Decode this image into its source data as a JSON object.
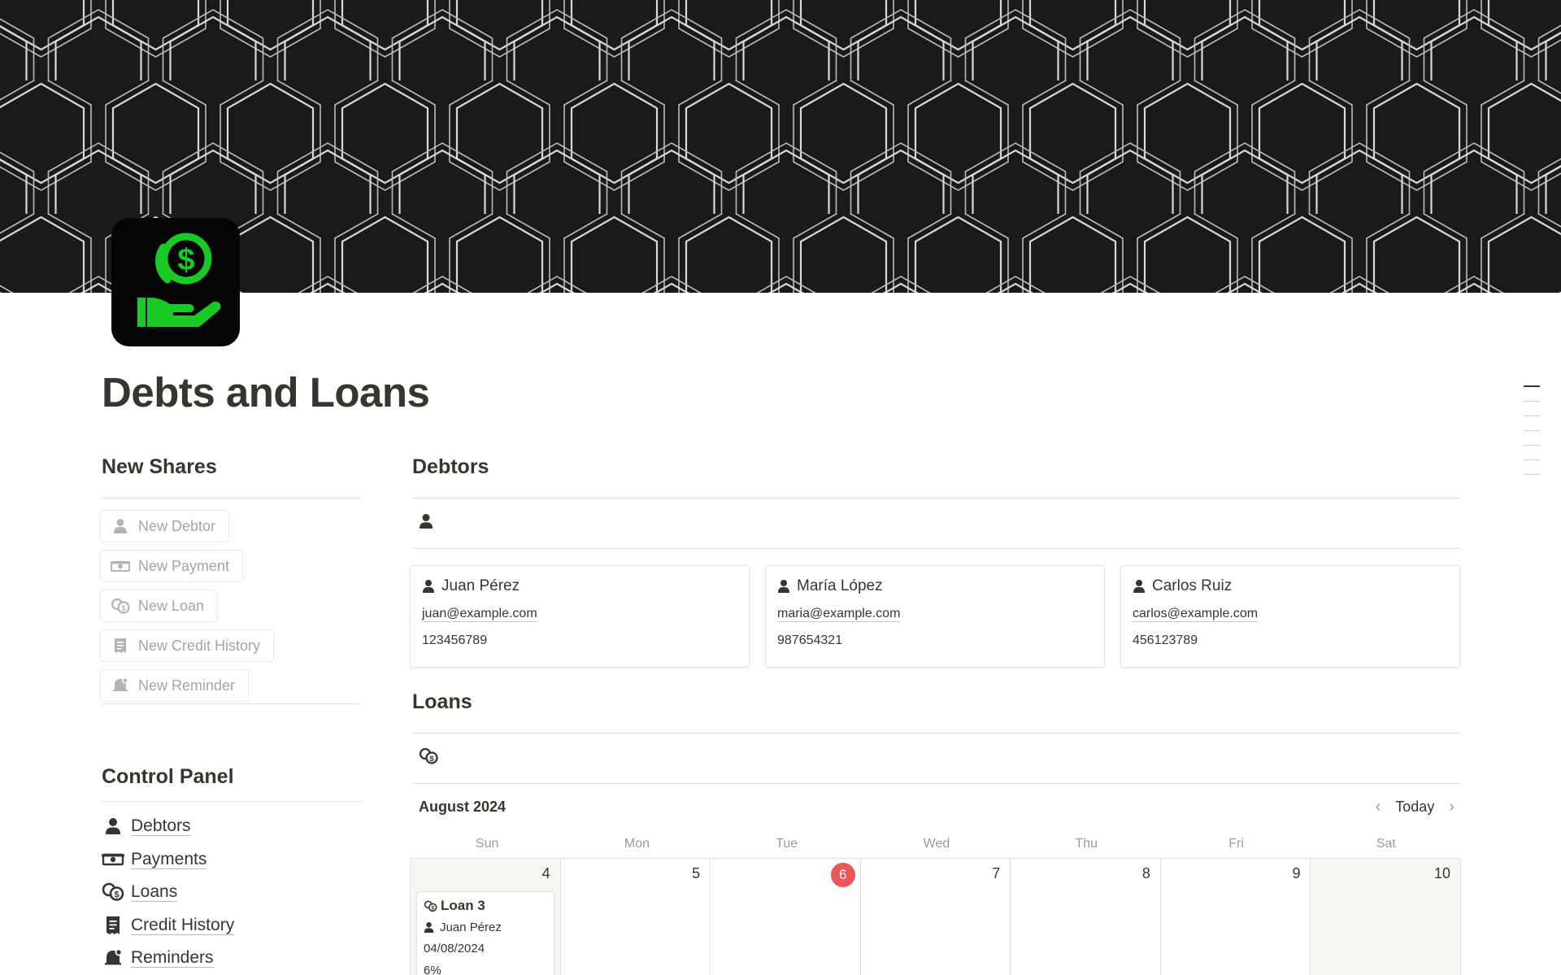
{
  "page": {
    "title": "Debts and Loans"
  },
  "icon": {
    "name": "hand-dollar-icon",
    "accent": "#18c928",
    "background": "#050505"
  },
  "new_shares": {
    "heading": "New Shares",
    "buttons": [
      {
        "label": "New Debtor",
        "icon": "person-icon"
      },
      {
        "label": "New Payment",
        "icon": "money-icon"
      },
      {
        "label": "New Loan",
        "icon": "coins-icon"
      },
      {
        "label": "New Credit History",
        "icon": "receipt-icon"
      },
      {
        "label": "New Reminder",
        "icon": "bell-icon"
      }
    ]
  },
  "control_panel": {
    "heading": "Control Panel",
    "items": [
      {
        "label": "Debtors",
        "icon": "person-icon"
      },
      {
        "label": "Payments",
        "icon": "money-icon"
      },
      {
        "label": "Loans",
        "icon": "coins-icon"
      },
      {
        "label": "Credit History",
        "icon": "receipt-icon"
      },
      {
        "label": "Reminders",
        "icon": "bell-icon"
      }
    ]
  },
  "debtors": {
    "heading": "Debtors",
    "cards": [
      {
        "name": "Juan Pérez",
        "email": "juan@example.com",
        "phone": "123456789"
      },
      {
        "name": "María López",
        "email": "maria@example.com",
        "phone": "987654321"
      },
      {
        "name": "Carlos Ruiz",
        "email": "carlos@example.com",
        "phone": "456123789"
      }
    ]
  },
  "loans": {
    "heading": "Loans",
    "calendar": {
      "month": "August 2024",
      "today_label": "Today",
      "weekdays": [
        "Sun",
        "Mon",
        "Tue",
        "Wed",
        "Thu",
        "Fri",
        "Sat"
      ],
      "days": [
        "4",
        "5",
        "6",
        "7",
        "8",
        "9",
        "10"
      ],
      "today_index": 2,
      "today_color": "#eb5757"
    },
    "entry": {
      "title": "Loan 3",
      "person": "Juan Pérez",
      "date": "04/08/2024",
      "rate": "6%"
    }
  }
}
